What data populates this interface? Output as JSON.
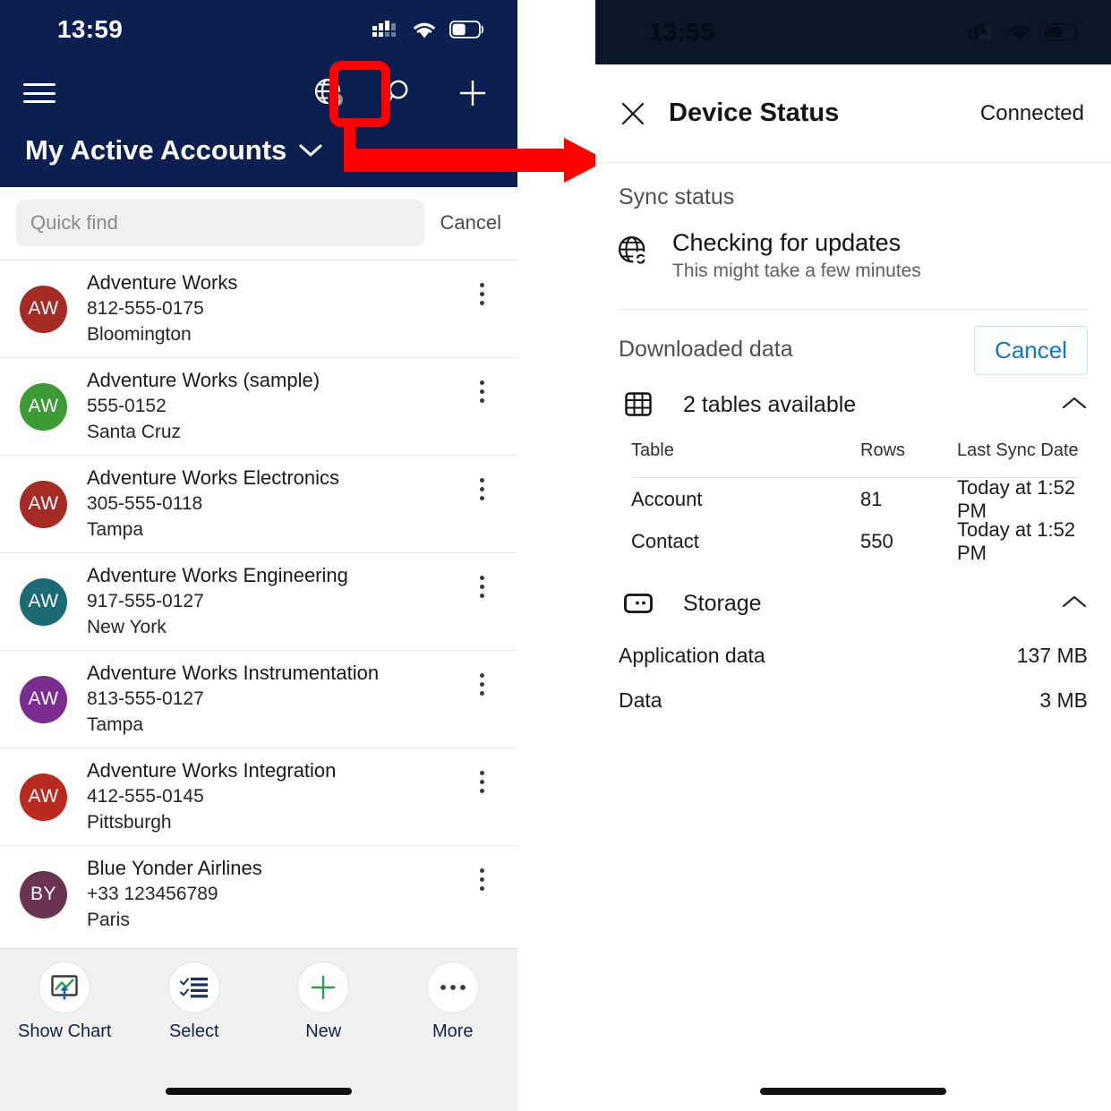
{
  "left_phone": {
    "status_bar": {
      "time": "13:59",
      "icons": [
        "cellular-icon",
        "wifi-icon",
        "battery-icon"
      ]
    },
    "nav": {
      "menu_icon": "hamburger-menu-icon",
      "actions": [
        {
          "name": "globe-sync-icon",
          "label": "Sync status"
        },
        {
          "name": "search-icon",
          "label": "Search"
        },
        {
          "name": "plus-icon",
          "label": "New"
        }
      ]
    },
    "view_title": "My Active Accounts",
    "view_title_chevron": "chevron-down-icon",
    "search": {
      "placeholder": "Quick find",
      "value": "",
      "cancel_label": "Cancel"
    },
    "accounts": [
      {
        "initials": "AW",
        "color": "#A72B25",
        "name": "Adventure Works",
        "phone": "812-555-0175",
        "city": "Bloomington"
      },
      {
        "initials": "AW",
        "color": "#3D9B35",
        "name": "Adventure Works (sample)",
        "phone": "555-0152",
        "city": "Santa Cruz"
      },
      {
        "initials": "AW",
        "color": "#A72B25",
        "name": "Adventure Works Electronics",
        "phone": "305-555-0118",
        "city": "Tampa"
      },
      {
        "initials": "AW",
        "color": "#1B6B75",
        "name": "Adventure Works Engineering",
        "phone": "917-555-0127",
        "city": "New York"
      },
      {
        "initials": "AW",
        "color": "#7B2C8F",
        "name": "Adventure Works Instrumentation",
        "phone": "813-555-0127",
        "city": "Tampa"
      },
      {
        "initials": "AW",
        "color": "#B92B1F",
        "name": "Adventure Works Integration",
        "phone": "412-555-0145",
        "city": "Pittsburgh"
      },
      {
        "initials": "BY",
        "color": "#6B3352",
        "name": "Blue Yonder Airlines",
        "phone": "+33 123456789",
        "city": "Paris"
      }
    ],
    "bottom_bar": [
      {
        "icon": "show-chart-icon",
        "label": "Show Chart"
      },
      {
        "icon": "select-list-icon",
        "label": "Select"
      },
      {
        "icon": "plus-icon",
        "label": "New"
      },
      {
        "icon": "more-ellipsis-icon",
        "label": "More"
      }
    ]
  },
  "right_phone": {
    "status_bar": {
      "time": "13:55",
      "icons": [
        "cellular-icon",
        "wifi-icon",
        "battery-icon"
      ]
    },
    "header": {
      "close_icon": "close-x-icon",
      "title": "Device Status",
      "connection_status": "Connected"
    },
    "sync_section": {
      "label": "Sync status",
      "icon": "globe-sync-icon",
      "title": "Checking for updates",
      "subtitle": "This might take a few minutes"
    },
    "downloaded": {
      "label": "Downloaded data",
      "cancel_label": "Cancel",
      "group": {
        "icon": "table-grid-icon",
        "title": "2 tables available",
        "chevron": "chevron-up-icon"
      },
      "columns": [
        "Table",
        "Rows",
        "Last Sync Date"
      ],
      "rows": [
        {
          "table": "Account",
          "rows": "81",
          "last_sync": "Today at 1:52 PM"
        },
        {
          "table": "Contact",
          "rows": "550",
          "last_sync": "Today at 1:52 PM"
        }
      ]
    },
    "storage": {
      "group": {
        "icon": "storage-icon",
        "title": "Storage",
        "chevron": "chevron-up-icon"
      },
      "items": [
        {
          "label": "Application data",
          "value": "137 MB"
        },
        {
          "label": "Data",
          "value": "3 MB"
        }
      ]
    }
  },
  "annotation": {
    "color": "#FF0000",
    "target_icon": "globe-sync-icon"
  },
  "colors": {
    "nav_navy": "#0B2050",
    "accent_blue": "#0F76C8",
    "annotation_red": "#FF0000"
  }
}
